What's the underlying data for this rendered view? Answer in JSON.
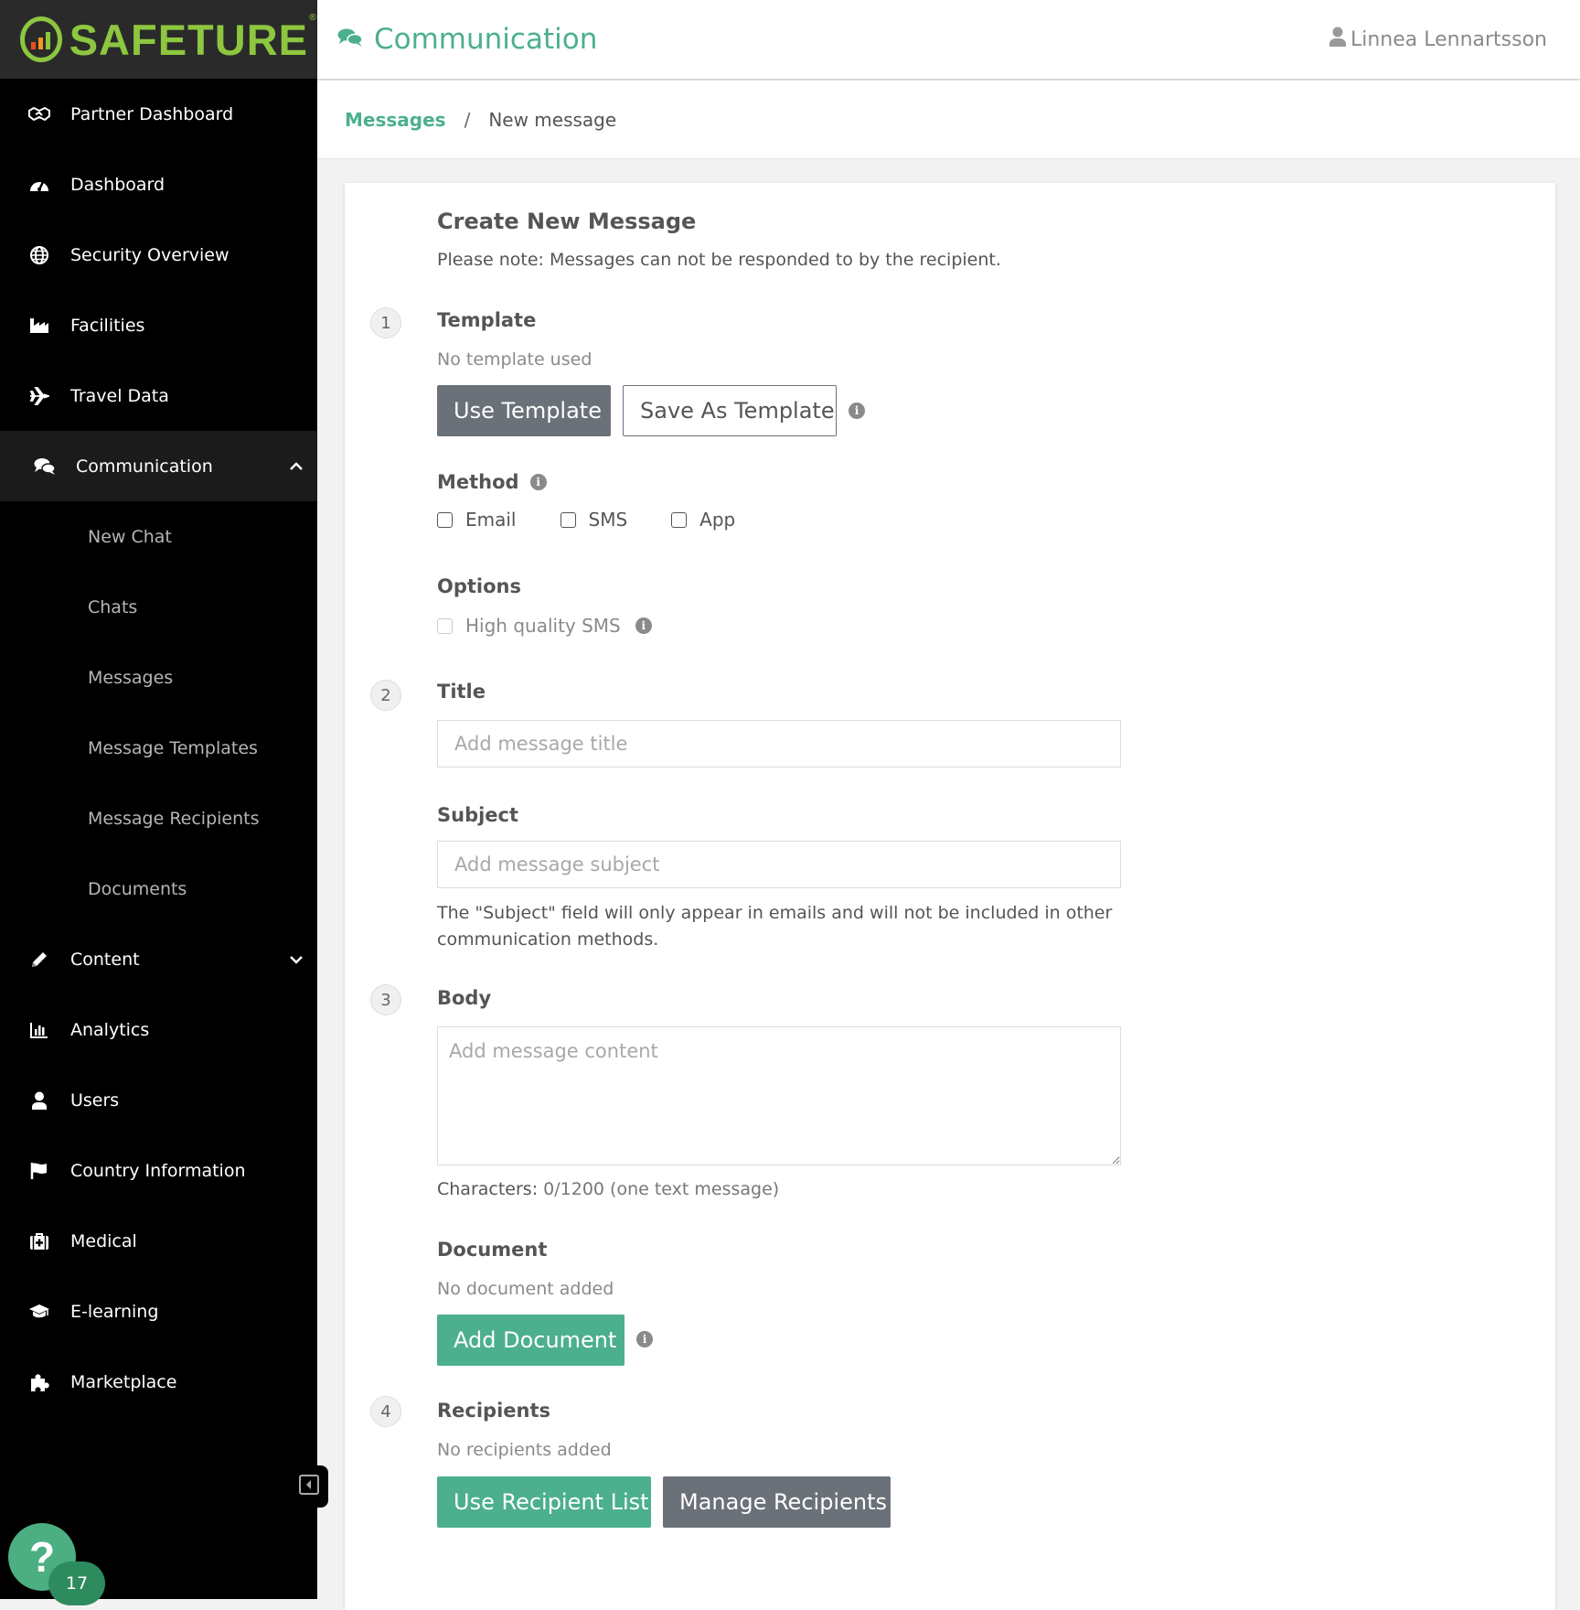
{
  "brand": {
    "name": "SAFETURE",
    "reg": "®",
    "colors": {
      "green": "#8dc63f",
      "accent": "#4caf8e"
    }
  },
  "header": {
    "title": "Communication",
    "title_icon": "comments-icon",
    "user": "Linnea Lennartsson",
    "user_icon": "user-icon"
  },
  "breadcrumb": {
    "parent": "Messages",
    "separator": "/",
    "current": "New message"
  },
  "sidebar": {
    "items": [
      {
        "label": "Partner Dashboard",
        "icon": "handshake-icon"
      },
      {
        "label": "Dashboard",
        "icon": "gauge-icon"
      },
      {
        "label": "Security Overview",
        "icon": "globe-icon"
      },
      {
        "label": "Facilities",
        "icon": "industry-icon"
      },
      {
        "label": "Travel Data",
        "icon": "plane-icon"
      },
      {
        "label": "Communication",
        "icon": "comments-icon",
        "active": true,
        "expanded": true
      }
    ],
    "sub_items": [
      {
        "label": "New Chat"
      },
      {
        "label": "Chats"
      },
      {
        "label": "Messages"
      },
      {
        "label": "Message Templates"
      },
      {
        "label": "Message Recipients"
      },
      {
        "label": "Documents"
      }
    ],
    "items_after": [
      {
        "label": "Content",
        "icon": "pencil-icon",
        "expandable": true
      },
      {
        "label": "Analytics",
        "icon": "bar-chart-icon"
      },
      {
        "label": "Users",
        "icon": "user-icon"
      },
      {
        "label": "Country Information",
        "icon": "flag-icon"
      },
      {
        "label": "Medical",
        "icon": "medkit-icon"
      },
      {
        "label": "E-learning",
        "icon": "graduation-cap-icon"
      },
      {
        "label": "Marketplace",
        "icon": "puzzle-icon"
      }
    ],
    "help": {
      "label": "?",
      "badge": "17"
    }
  },
  "form": {
    "heading": "Create New Message",
    "note": "Please note: Messages can not be responded to by the recipient.",
    "template": {
      "step": "1",
      "label": "Template",
      "status": "No template used",
      "use_button": "Use Template",
      "save_button": "Save As Template"
    },
    "method": {
      "label": "Method",
      "options": [
        "Email",
        "SMS",
        "App"
      ]
    },
    "options": {
      "label": "Options",
      "high_quality_sms": "High quality SMS"
    },
    "title": {
      "step": "2",
      "label": "Title",
      "placeholder": "Add message title",
      "value": ""
    },
    "subject": {
      "label": "Subject",
      "placeholder": "Add message subject",
      "value": "",
      "help": "The \"Subject\" field will only appear in emails and will not be included in other communication methods."
    },
    "body": {
      "step": "3",
      "label": "Body",
      "placeholder": "Add message content",
      "value": "",
      "chars_label": "Characters:",
      "chars_value": "0/1200 (one text message)"
    },
    "document": {
      "label": "Document",
      "status": "No document added",
      "add_button": "Add Document"
    },
    "recipients": {
      "step": "4",
      "label": "Recipients",
      "status": "No recipients added",
      "list_button": "Use Recipient List",
      "manage_button": "Manage Recipients"
    }
  }
}
